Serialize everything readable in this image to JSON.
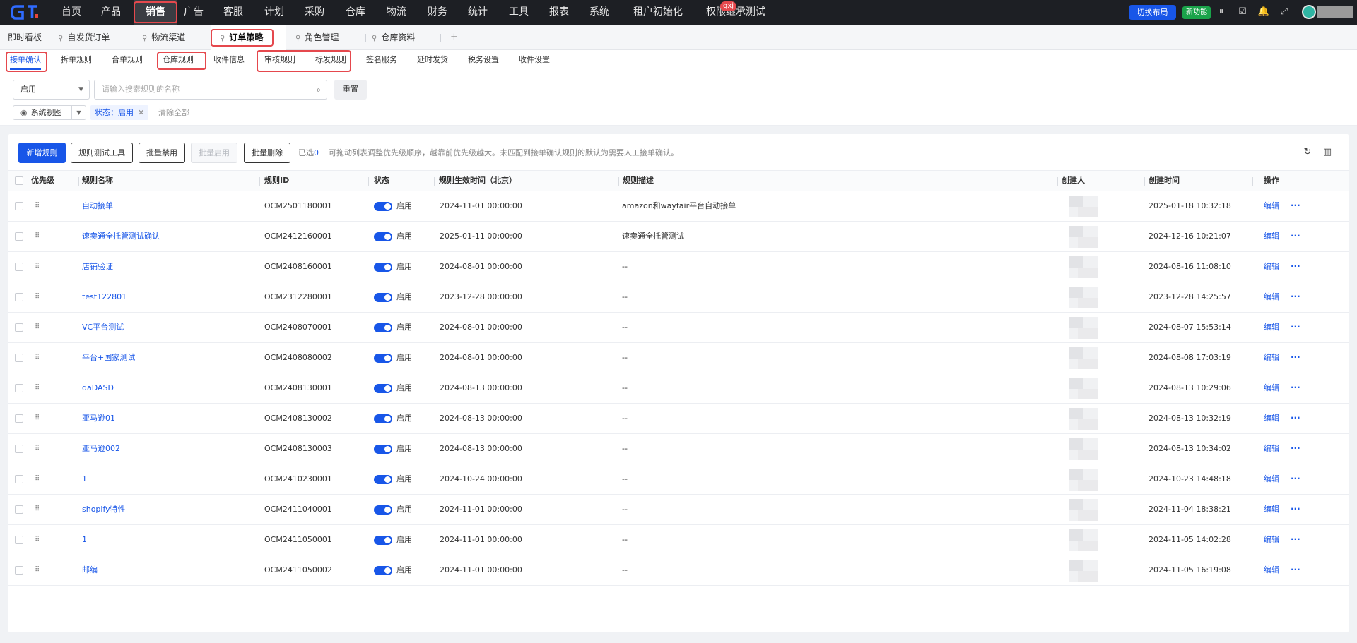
{
  "colors": {
    "accent": "#1856e8",
    "nav_bg": "#1d1f24",
    "highlight": "#e5484d",
    "new_badge": "#1aa34a"
  },
  "topnav": {
    "items": [
      "首页",
      "产品",
      "销售",
      "广告",
      "客服",
      "计划",
      "采购",
      "仓库",
      "物流",
      "财务",
      "统计",
      "工具",
      "报表",
      "系统",
      "租户初始化",
      "权限继承测试"
    ],
    "active": "销售",
    "badge": "qxj",
    "switch_layout": "切换布局",
    "new_feature": "新功能",
    "icons": [
      "pause-icon",
      "task-icon",
      "bell-icon",
      "fullscreen-icon"
    ]
  },
  "page_tabs": [
    "即时看板",
    "自发货订单",
    "物流渠道",
    "订单策略",
    "角色管理",
    "仓库资料"
  ],
  "page_tab_active": "订单策略",
  "add_tab": "+",
  "sub_tabs": [
    "接单确认",
    "拆单规则",
    "合单规则",
    "仓库规则",
    "收件信息",
    "审核规则",
    "标发规则",
    "签名服务",
    "延时发货",
    "税务设置",
    "收件设置"
  ],
  "sub_tab_active": "接单确认",
  "filters": {
    "status_select": "启用",
    "search_placeholder": "请输入搜索规则的名称",
    "reset": "重置",
    "view": "系统视图",
    "chip": "状态：启用",
    "clear_all": "清除全部"
  },
  "toolbar": {
    "new_rule": "新增规则",
    "test_tool": "规则测试工具",
    "batch_disable": "批量禁用",
    "batch_enable": "批量启用",
    "batch_delete": "批量删除",
    "selected_label": "已选",
    "selected_count": "0",
    "hint": "可拖动列表调整优先级顺序，越靠前优先级越大。未匹配到接单确认规则的默认为需要人工接单确认。"
  },
  "table": {
    "columns": [
      "优先级",
      "规则名称",
      "规则ID",
      "状态",
      "规则生效时间（北京）",
      "规则描述",
      "创建人",
      "创建时间",
      "操作"
    ],
    "edit_label": "编辑",
    "more_label": "···",
    "rows": [
      {
        "name": "自动接单",
        "id": "OCM2501180001",
        "status": "启用",
        "enabled": true,
        "effective": "2024-11-01 00:00:00",
        "desc": "amazon和wayfair平台自动接单",
        "created": "2025-01-18 10:32:18"
      },
      {
        "name": "速卖通全托管测试确认",
        "id": "OCM2412160001",
        "status": "启用",
        "enabled": true,
        "effective": "2025-01-11 00:00:00",
        "desc": "速卖通全托管测试",
        "created": "2024-12-16 10:21:07"
      },
      {
        "name": "店铺验证",
        "id": "OCM2408160001",
        "status": "启用",
        "enabled": true,
        "effective": "2024-08-01 00:00:00",
        "desc": "--",
        "created": "2024-08-16 11:08:10"
      },
      {
        "name": "test122801",
        "id": "OCM2312280001",
        "status": "启用",
        "enabled": true,
        "effective": "2023-12-28 00:00:00",
        "desc": "--",
        "created": "2023-12-28 14:25:57"
      },
      {
        "name": "VC平台测试",
        "id": "OCM2408070001",
        "status": "启用",
        "enabled": true,
        "effective": "2024-08-01 00:00:00",
        "desc": "--",
        "created": "2024-08-07 15:53:14"
      },
      {
        "name": "平台+国家测试",
        "id": "OCM2408080002",
        "status": "启用",
        "enabled": true,
        "effective": "2024-08-01 00:00:00",
        "desc": "--",
        "created": "2024-08-08 17:03:19"
      },
      {
        "name": "daDASD",
        "id": "OCM2408130001",
        "status": "启用",
        "enabled": true,
        "effective": "2024-08-13 00:00:00",
        "desc": "--",
        "created": "2024-08-13 10:29:06"
      },
      {
        "name": "亚马逊01",
        "id": "OCM2408130002",
        "status": "启用",
        "enabled": true,
        "effective": "2024-08-13 00:00:00",
        "desc": "--",
        "created": "2024-08-13 10:32:19"
      },
      {
        "name": "亚马逊002",
        "id": "OCM2408130003",
        "status": "启用",
        "enabled": true,
        "effective": "2024-08-13 00:00:00",
        "desc": "--",
        "created": "2024-08-13 10:34:02"
      },
      {
        "name": "1",
        "id": "OCM2410230001",
        "status": "启用",
        "enabled": true,
        "effective": "2024-10-24 00:00:00",
        "desc": "--",
        "created": "2024-10-23 14:48:18"
      },
      {
        "name": "shopify特性",
        "id": "OCM2411040001",
        "status": "启用",
        "enabled": true,
        "effective": "2024-11-01 00:00:00",
        "desc": "--",
        "created": "2024-11-04 18:38:21"
      },
      {
        "name": "1",
        "id": "OCM2411050001",
        "status": "启用",
        "enabled": true,
        "effective": "2024-11-01 00:00:00",
        "desc": "--",
        "created": "2024-11-05 14:02:28"
      },
      {
        "name": "邮编",
        "id": "OCM2411050002",
        "status": "启用",
        "enabled": true,
        "effective": "2024-11-01 00:00:00",
        "desc": "--",
        "created": "2024-11-05 16:19:08"
      }
    ]
  }
}
